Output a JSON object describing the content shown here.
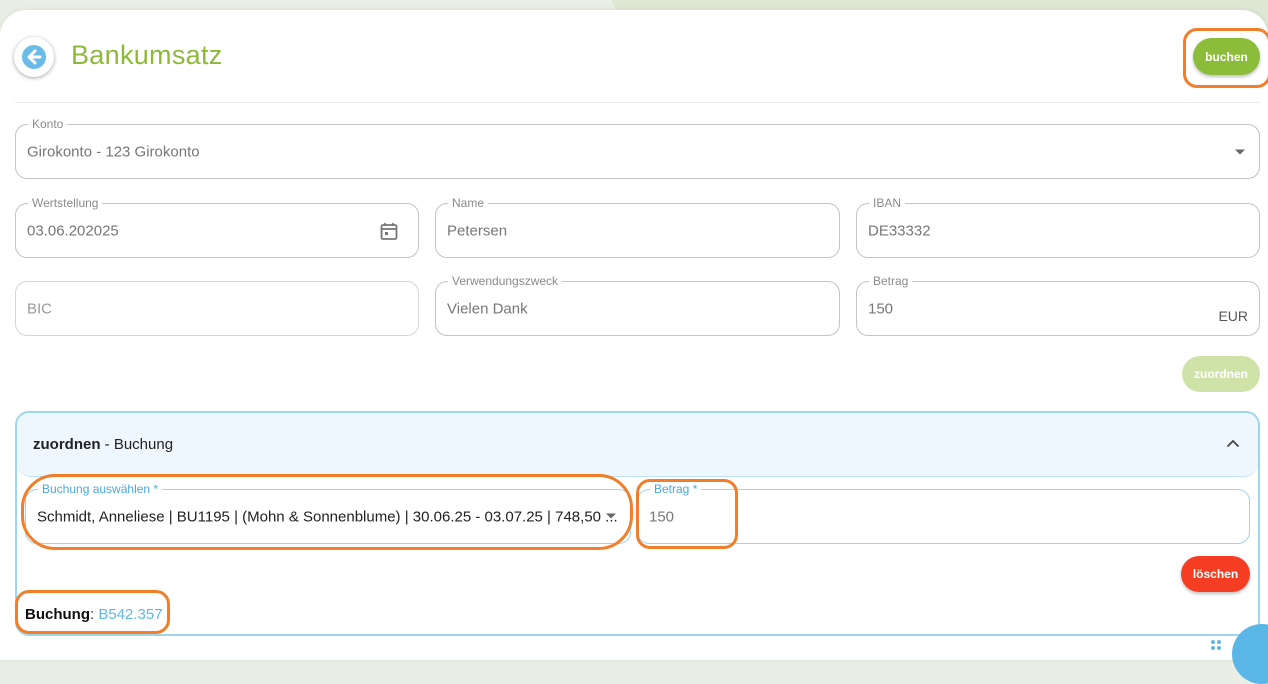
{
  "header": {
    "title": "Bankumsatz",
    "buchen_label": "buchen"
  },
  "konto": {
    "label": "Konto",
    "value": "Girokonto - 123 Girokonto"
  },
  "wertstellung": {
    "label": "Wertstellung",
    "value": "03.06.202025"
  },
  "name": {
    "label": "Name",
    "value": "Petersen"
  },
  "iban": {
    "label": "IBAN",
    "value": "DE33332"
  },
  "bic": {
    "placeholder": "BIC"
  },
  "verwendungszweck": {
    "label": "Verwendungszweck",
    "value": "Vielen Dank"
  },
  "betrag": {
    "label": "Betrag",
    "value": "150",
    "currency": "EUR"
  },
  "zuordnen_label": "zuordnen",
  "panel": {
    "title_bold": "zuordnen",
    "title_rest": " - Buchung",
    "buchung_select": {
      "label": "Buchung auswählen *",
      "value": "Schmidt, Anneliese | BU1195 | (Mohn & Sonnenblume) | 30.06.25 - 03.07.25 |  748,50 ..."
    },
    "betrag": {
      "label": "Betrag *",
      "value": "150"
    },
    "loeschen_label": "löschen",
    "buchung_label": "Buchung",
    "buchung_value": "B542.357"
  },
  "colors": {
    "accent_green": "#8cbd3a",
    "danger_red": "#f53d23",
    "info_blue": "#61b6e6",
    "highlight_orange": "#f07e2a"
  },
  "icons": [
    "back-arrow-icon",
    "calendar-icon",
    "dropdown-caret-icon",
    "chevron-up-icon",
    "drag-handle-icon"
  ]
}
